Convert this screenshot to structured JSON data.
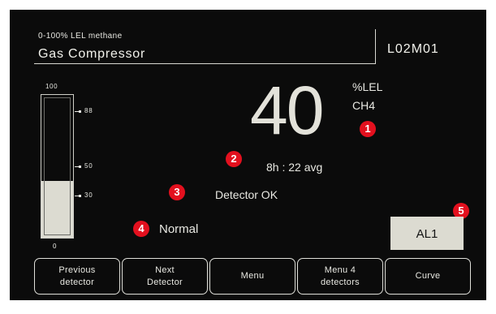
{
  "header": {
    "subtitle": "0-100% LEL methane",
    "title": "Gas Compressor",
    "device_code": "L02M01"
  },
  "gauge": {
    "max_label": "100",
    "min_label": "0",
    "level_percent": 40,
    "ticks": [
      {
        "label": "88",
        "value": 88
      },
      {
        "label": "50",
        "value": 50
      },
      {
        "label": "30",
        "value": 30
      }
    ]
  },
  "reading": {
    "value": "40",
    "unit": "%LEL",
    "gas": "CH4",
    "average": "8h : 22 avg",
    "status": "Detector OK",
    "mode": "Normal"
  },
  "alarm": {
    "label": "AL1"
  },
  "callouts": [
    "1",
    "2",
    "3",
    "4",
    "5"
  ],
  "buttons": [
    {
      "label": "Previous\ndetector"
    },
    {
      "label": "Next\nDetector"
    },
    {
      "label": "Menu"
    },
    {
      "label": "Menu 4\ndetectors"
    },
    {
      "label": "Curve"
    }
  ],
  "colors": {
    "screen_bg": "#0b0b0b",
    "text": "#e8e8e2",
    "gauge_fill": "#dcdbd1",
    "callout_red": "#e3101e"
  }
}
